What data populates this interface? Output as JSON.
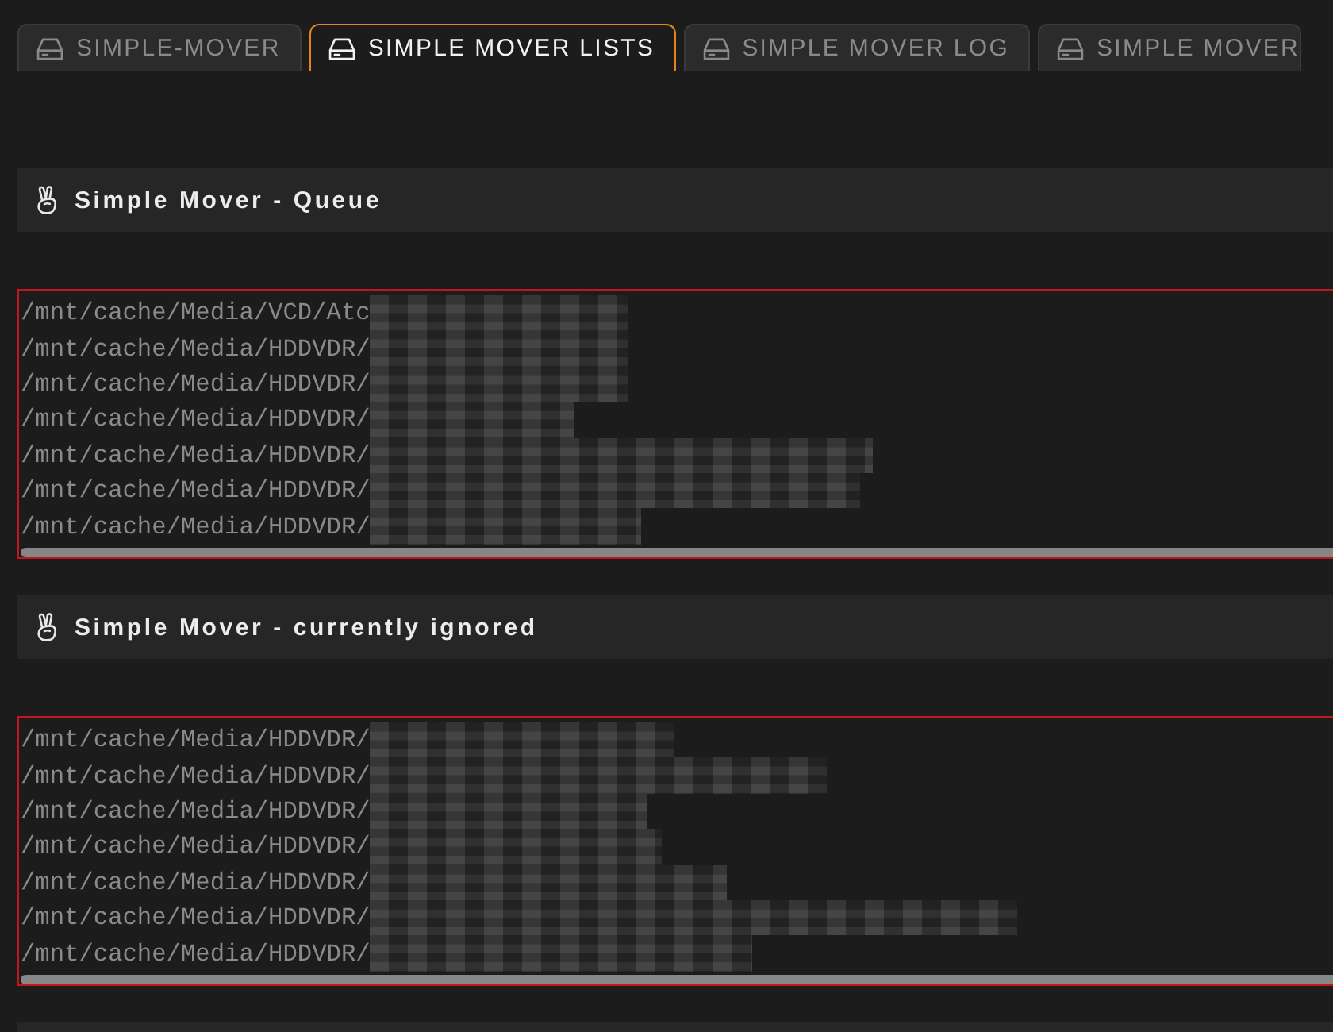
{
  "tabs": [
    {
      "label": "SIMPLE-MOVER",
      "selected": false
    },
    {
      "label": "SIMPLE MOVER LISTS",
      "selected": true
    },
    {
      "label": "SIMPLE MOVER LOG",
      "selected": false
    },
    {
      "label": "SIMPLE MOVER",
      "selected": false
    }
  ],
  "sections": [
    {
      "kind": "panel",
      "title": "Simple Mover - Queue",
      "lines": [
        {
          "text": "/mnt/cache/Media/VCD/Atc",
          "redacted": true
        },
        {
          "text": "/mnt/cache/Media/HDDVDR/",
          "redacted": true
        },
        {
          "text": "/mnt/cache/Media/HDDVDR/",
          "redacted": true
        },
        {
          "text": "/mnt/cache/Media/HDDVDR/",
          "redacted": true
        },
        {
          "text": "/mnt/cache/Media/HDDVDR/",
          "redacted": true
        },
        {
          "text": "/mnt/cache/Media/HDDVDR/",
          "redacted": true
        },
        {
          "text": "/mnt/cache/Media/HDDVDR/",
          "redacted": true
        }
      ]
    },
    {
      "kind": "panel",
      "title": "Simple Mover - currently ignored",
      "lines": [
        {
          "text": "/mnt/cache/Media/HDDVDR/",
          "redacted": true
        },
        {
          "text": "/mnt/cache/Media/HDDVDR/",
          "redacted": true
        },
        {
          "text": "/mnt/cache/Media/HDDVDR/",
          "redacted": true
        },
        {
          "text": "/mnt/cache/Media/HDDVDR/",
          "redacted": true
        },
        {
          "text": "/mnt/cache/Media/HDDVDR/",
          "redacted": true
        },
        {
          "text": "/mnt/cache/Media/HDDVDR/",
          "redacted": true
        },
        {
          "text": "/mnt/cache/Media/HDDVDR/",
          "redacted": true
        }
      ]
    },
    {
      "kind": "cut-off"
    }
  ]
}
